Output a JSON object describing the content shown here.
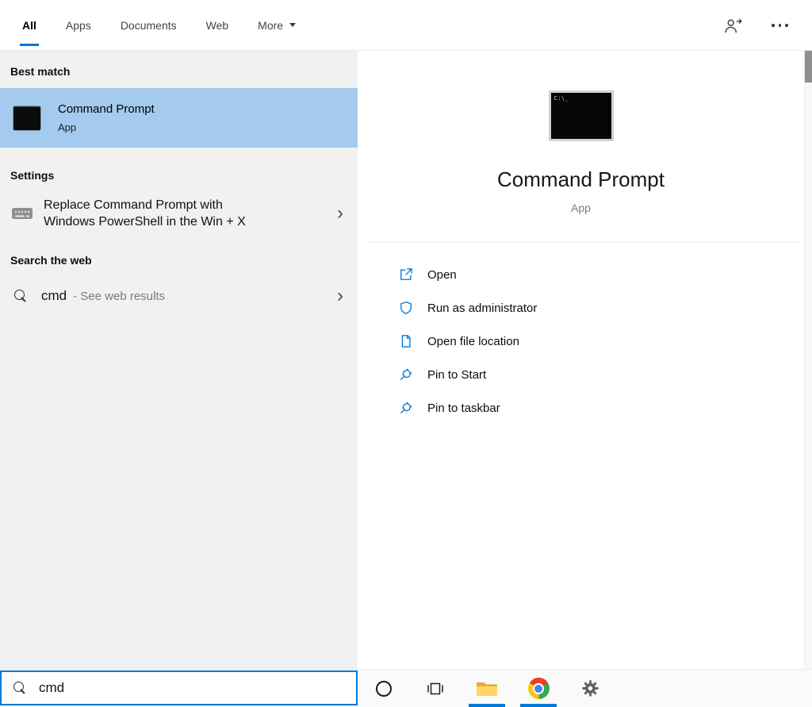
{
  "colors": {
    "accent": "#0078d7",
    "highlight": "#a4cbee"
  },
  "icons": {
    "chevron": "›"
  },
  "tabs": {
    "items": [
      {
        "label": "All",
        "active": true
      },
      {
        "label": "Apps"
      },
      {
        "label": "Documents"
      },
      {
        "label": "Web"
      },
      {
        "label": "More"
      }
    ]
  },
  "left": {
    "best_match_header": "Best match",
    "best_match": {
      "title": "Command Prompt",
      "subtitle": "App"
    },
    "settings_header": "Settings",
    "settings_item": {
      "line1": "Replace Command Prompt with",
      "line2": "Windows PowerShell in the Win + X"
    },
    "web_header": "Search the web",
    "web_item": {
      "query": "cmd",
      "suffix": "- See web results"
    }
  },
  "preview": {
    "icon_text": "C:\\_",
    "title": "Command Prompt",
    "subtitle": "App",
    "actions": [
      {
        "label": "Open"
      },
      {
        "label": "Run as administrator"
      },
      {
        "label": "Open file location"
      },
      {
        "label": "Pin to Start"
      },
      {
        "label": "Pin to taskbar"
      }
    ]
  },
  "search": {
    "value": "cmd"
  },
  "taskbar": {
    "buttons": [
      "cortana",
      "task-view",
      "file-explorer",
      "chrome",
      "settings"
    ],
    "running": [
      "file-explorer",
      "chrome"
    ]
  }
}
